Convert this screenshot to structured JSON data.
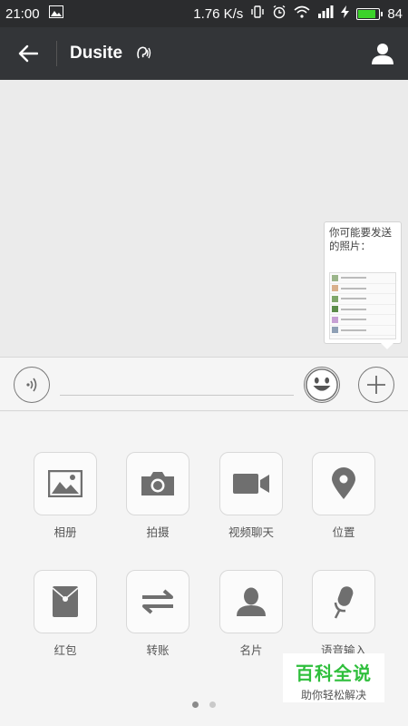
{
  "status_bar": {
    "time": "21:00",
    "speed": "1.76 K/s",
    "battery": "84"
  },
  "title_bar": {
    "title": "Dusite"
  },
  "photo_tip": {
    "text": "你可能要发送的照片："
  },
  "panel": {
    "items": [
      {
        "label": "相册",
        "icon": "photo-album-icon"
      },
      {
        "label": "拍摄",
        "icon": "camera-icon"
      },
      {
        "label": "视频聊天",
        "icon": "video-call-icon"
      },
      {
        "label": "位置",
        "icon": "location-pin-icon"
      },
      {
        "label": "红包",
        "icon": "red-packet-icon"
      },
      {
        "label": "转账",
        "icon": "transfer-icon"
      },
      {
        "label": "名片",
        "icon": "contact-card-icon"
      },
      {
        "label": "语音输入",
        "icon": "voice-input-icon"
      }
    ],
    "pages": 2,
    "current_page": 1
  },
  "watermark": {
    "main": "百科全说",
    "sub": "助你轻松解决"
  }
}
